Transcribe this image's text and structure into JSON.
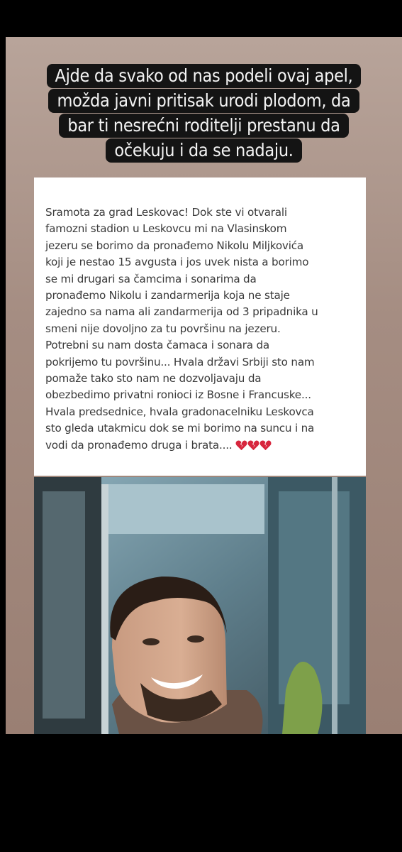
{
  "story": {
    "caption_lines": [
      "Ajde da svako od nas podeli ovaj apel,",
      "možda javni pritisak urodi plodom, da",
      "bar ti nesrećni roditelji prestanu da",
      "očekuju i da se nadaju."
    ]
  },
  "post": {
    "text": "Sramota za grad Leskovac! Dok ste vi otvarali\nfamozni stadion u Leskovcu mi na Vlasinskom\njezeru se borimo da pronađemo Nikolu Miljkovića\nkoji je nestao 15 avgusta i jos uvek nista a borimo\nse mi drugari sa čamcima i sonarima da\npronađemo Nikolu i zandarmerija koja ne staje\nzajedno sa nama ali zandarmerija od 3 pripadnika u\nsmeni nije dovoljno za tu površinu na jezeru.\nPotrebni su nam dosta čamaca i sonara da\npokrijemo tu površinu... Hvala državi Srbiji sto nam\npomaže tako sto nam ne dozvoljavaju da\nobezbedimo privatni ronioci iz Bosne i Francuske...\nHvala predsednice, hvala gradonacelniku Leskovca\nsto gleda utakmicu dok se mi borimo na suncu i na\nvodi da pronađemo druga i brata....",
    "emoji": [
      "broken-heart-icon",
      "broken-heart-icon",
      "broken-heart-icon"
    ],
    "heart_color": "#d7263d"
  },
  "colors": {
    "caption_bg": "#141414",
    "caption_text": "#f4f4f4",
    "post_text": "#3a3a3a",
    "background": "#000000"
  }
}
